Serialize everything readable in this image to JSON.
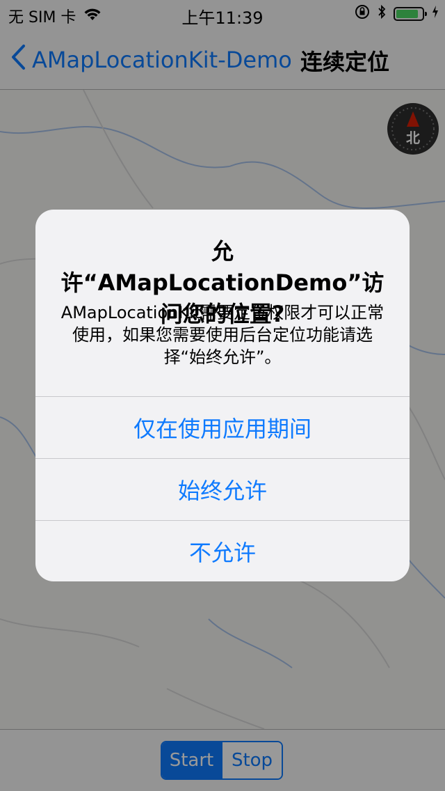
{
  "status_bar": {
    "carrier": "无 SIM 卡",
    "time": "上午11:39",
    "battery_level": 0.85,
    "icons": [
      "wifi-icon",
      "orientation-lock-icon",
      "bluetooth-icon",
      "battery-icon",
      "charging-icon"
    ]
  },
  "nav": {
    "back_label": "AMapLocationKit-Demo",
    "title": "连续定位"
  },
  "map": {
    "compass_label": "北"
  },
  "alert": {
    "title": "允许“AMapLocationDemo”访问您的位置?",
    "message": "AMapLocationKit需要定位权限才可以正常使用，如果您需要使用后台定位功能请选择“始终允许”。",
    "buttons": [
      {
        "label": "仅在使用应用期间"
      },
      {
        "label": "始终允许"
      },
      {
        "label": "不允许"
      }
    ]
  },
  "toolbar": {
    "segments": [
      {
        "label": "Start",
        "selected": true
      },
      {
        "label": "Stop",
        "selected": false
      }
    ]
  },
  "colors": {
    "accent": "#0e7afe",
    "battery": "#4cd964",
    "compass_needle": "#d81e06"
  }
}
